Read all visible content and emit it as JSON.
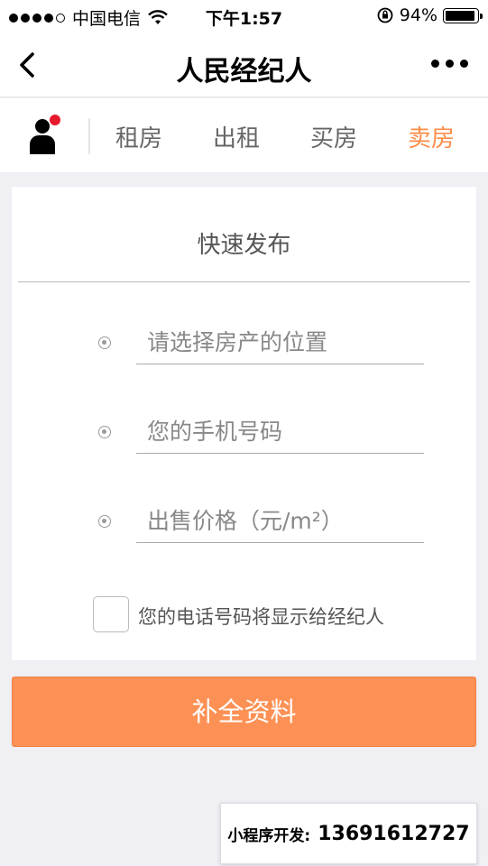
{
  "status_bar": {
    "carrier": "中国电信",
    "time": "下午1:57",
    "battery": "94%",
    "battery_level": 0.94
  },
  "nav": {
    "title": "人民经纪人"
  },
  "tabs": [
    {
      "label": "租房",
      "active": false
    },
    {
      "label": "出租",
      "active": false
    },
    {
      "label": "买房",
      "active": false
    },
    {
      "label": "卖房",
      "active": true
    }
  ],
  "form": {
    "title": "快速发布",
    "fields": [
      {
        "placeholder": "请选择房产的位置",
        "value": ""
      },
      {
        "placeholder": "您的手机号码",
        "value": ""
      },
      {
        "placeholder": "出售价格（元/m²）",
        "value": ""
      }
    ],
    "checkbox_label": "您的电话号码将显示给经纪人",
    "checkbox_checked": false
  },
  "submit_label": "补全资料",
  "footer": {
    "label": "小程序开发:",
    "phone": "13691612727"
  },
  "colors": {
    "accent": "#fd8c49",
    "button": "#fd9155",
    "badge": "#e8192c"
  }
}
